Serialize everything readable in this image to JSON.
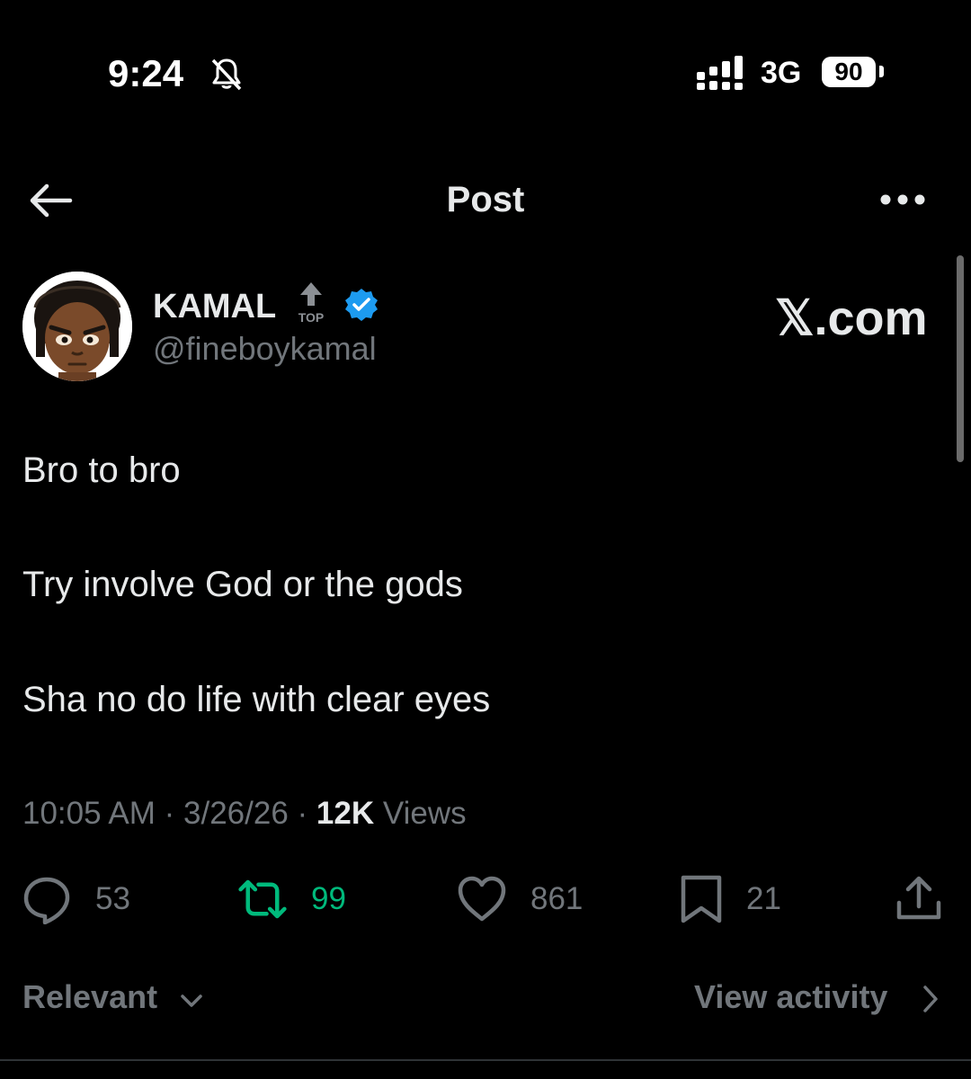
{
  "status_bar": {
    "time": "9:24",
    "network": "3G",
    "battery": "90"
  },
  "nav": {
    "title": "Post"
  },
  "author": {
    "name": "KAMAL",
    "badge_text": "TOP",
    "handle": "@fineboykamal",
    "verified_color": "#1d9bf0"
  },
  "watermark": "𝕏.com",
  "post": {
    "lines": [
      "Bro to bro",
      "Try involve God or the gods",
      "Sha no do life with clear eyes"
    ],
    "time": "10:05 AM",
    "date": "3/26/26",
    "views_count": "12K",
    "views_label": "Views"
  },
  "actions": {
    "replies": "53",
    "reposts": "99",
    "likes": "861",
    "bookmarks": "21"
  },
  "footer": {
    "sort_label": "Relevant",
    "activity_label": "View activity"
  },
  "colors": {
    "background": "#000000",
    "text": "#e7e9ea",
    "muted": "#71767b",
    "repost_active": "#00ba7c",
    "verified": "#1d9bf0"
  }
}
